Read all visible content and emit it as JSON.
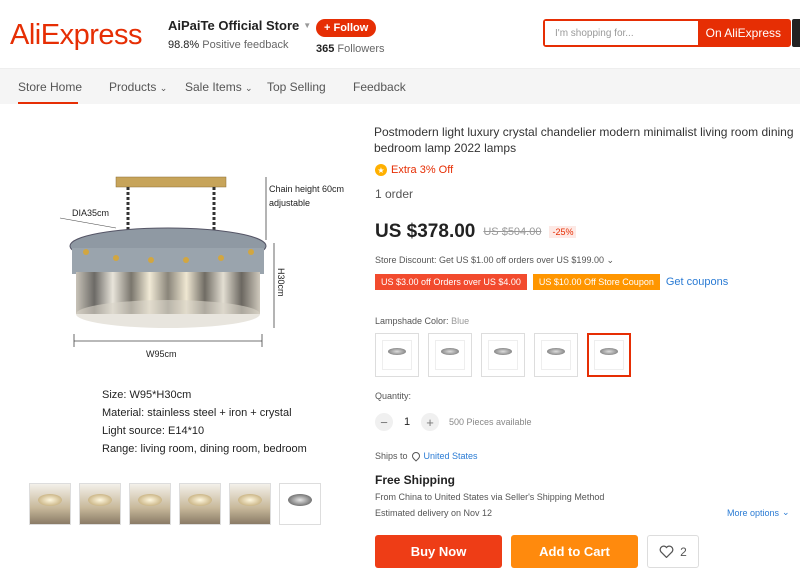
{
  "header": {
    "logo": "AliExpress",
    "store_name": "AiPaiTe Official Store",
    "positive_rate": "98.8%",
    "positive_label": "Positive feedback",
    "follow_label": "+ Follow",
    "followers_count": "365",
    "followers_label": "Followers",
    "search_placeholder": "I'm shopping for...",
    "search_button": "On AliExpress"
  },
  "nav": {
    "items": [
      "Store Home",
      "Products",
      "Sale Items",
      "Top Selling",
      "Feedback"
    ],
    "active": "Store Home"
  },
  "gallery": {
    "diagram_labels": {
      "chain": "Chain height 60cm",
      "adjustable": "adjustable",
      "dia": "DIA35cm",
      "height": "H30cm",
      "width": "W95cm"
    },
    "specs": [
      "Size: W95*H30cm",
      "Material: stainless steel + iron + crystal",
      "Light source: E14*10",
      "Range: living room, dining room, bedroom"
    ],
    "thumb_count": 6
  },
  "product": {
    "title": "Postmodern light luxury crystal chandelier modern minimalist living room dining bedroom lamp 2022 lamps",
    "extra_off": "Extra 3% Off",
    "orders": "1 order",
    "price": "US $378.00",
    "price_old": "US $504.00",
    "discount": "-25%",
    "store_discount": "Store Discount: Get US $1.00 off orders over US $199.00",
    "coupons": [
      "US $3.00 off Orders over US $4.00",
      "US $10.00 Off Store Coupon"
    ],
    "get_coupons": "Get coupons",
    "lampshade_label": "Lampshade Color:",
    "lampshade_value": "Blue",
    "quantity_label": "Quantity:",
    "quantity": "1",
    "available": "500 Pieces available",
    "ships_to_label": "Ships to",
    "ships_to": "United States",
    "shipping_title": "Free Shipping",
    "shipping_route": "From China to United States via Seller's Shipping Method",
    "estimated": "Estimated delivery on Nov 12",
    "more_options": "More options",
    "buy_now": "Buy Now",
    "add_to_cart": "Add to Cart",
    "wishlist_count": "2"
  },
  "colors": {
    "brand": "#e62e04",
    "buy": "#ee3d16",
    "cart": "#ff8a0d",
    "link": "#2a7bd4"
  }
}
